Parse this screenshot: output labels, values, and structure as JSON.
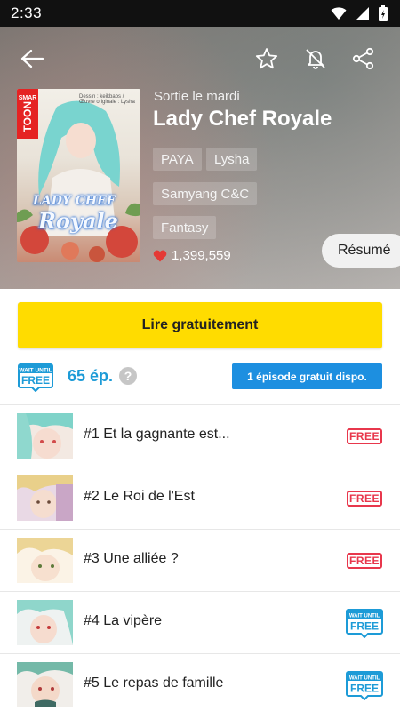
{
  "status_bar": {
    "time": "2:33"
  },
  "header": {
    "day_label": "Sortie le mardi",
    "title": "Lady Chef Royale"
  },
  "cover": {
    "brand_small": "SMAR",
    "brand_big": "TOON",
    "credits": "Dessin : keikbabs / Œuvre originale : Lysha",
    "title_line1": "LADY CHEF",
    "title_line2": "Royale"
  },
  "tags": [
    "PAYA",
    "Lysha",
    "Samyang C&C",
    "Fantasy"
  ],
  "likes": {
    "count": "1,399,559"
  },
  "resume_label": "Résumé",
  "read_button_label": "Lire gratuitement",
  "wait_badge": {
    "line1": "WAIT UNTIL",
    "line2": "FREE"
  },
  "episode_count": "65 ép.",
  "help_label": "?",
  "free_episode_label": "1 épisode gratuit dispo.",
  "episodes": [
    {
      "title": "#1 Et la gagnante est...",
      "badge": "FREE"
    },
    {
      "title": "#2 Le Roi de l'Est",
      "badge": "FREE"
    },
    {
      "title": "#3 Une alliée ?",
      "badge": "FREE"
    },
    {
      "title": "#4 La vipère",
      "badge": "WAIT UNTIL FREE"
    },
    {
      "title": "#5 Le repas de famille",
      "badge": "WAIT UNTIL FREE"
    }
  ],
  "colors": {
    "accent_yellow": "#ffdc00",
    "accent_blue": "#1d9bd7",
    "free_red": "#e8374c"
  }
}
